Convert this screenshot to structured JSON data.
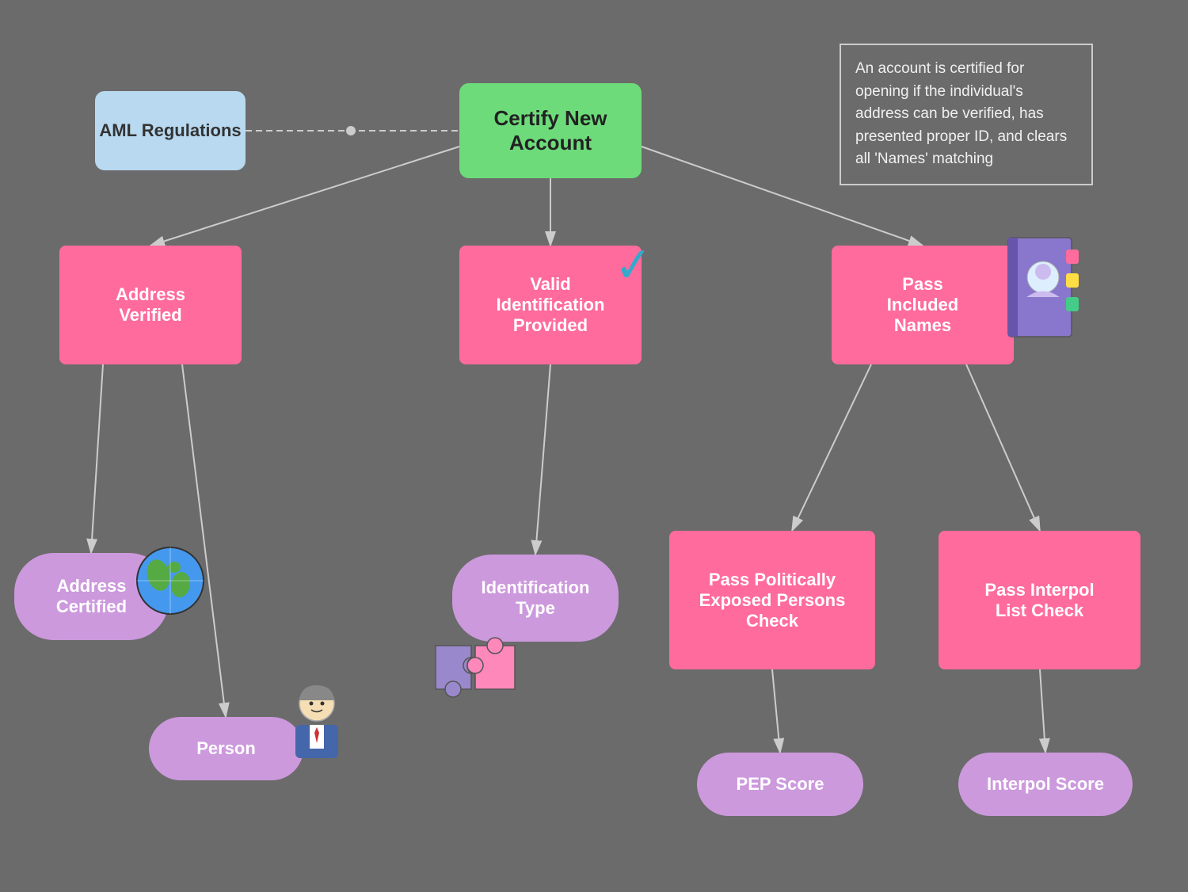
{
  "nodes": {
    "certify": {
      "label": "Certify New\nAccount"
    },
    "aml": {
      "label": "AML\nRegulations"
    },
    "address_verified": {
      "label": "Address\nVerified"
    },
    "valid_id": {
      "label": "Valid\nIdentification\nProvided"
    },
    "pass_included": {
      "label": "Pass\nIncluded\nNames"
    },
    "pass_pep": {
      "label": "Pass Politically\nExposed Persons\nCheck"
    },
    "pass_interpol": {
      "label": "Pass Interpol\nList Check"
    },
    "address_certified": {
      "label": "Address\nCertified"
    },
    "person": {
      "label": "Person"
    },
    "id_type": {
      "label": "Identification\nType"
    },
    "pep_score": {
      "label": "PEP Score"
    },
    "interpol_score": {
      "label": "Interpol Score"
    }
  },
  "note": {
    "text": "An account is certified for opening if the individual's address can be verified, has presented proper ID, and clears all 'Names' matching"
  },
  "colors": {
    "background": "#6b6b6b",
    "certify_green": "#6ddb7a",
    "pink": "#ff6b9d",
    "pill_purple": "#cc99dd",
    "aml_blue": "#b8d9f0",
    "checkmark_blue": "#33aacc",
    "arrow": "#cccccc"
  }
}
